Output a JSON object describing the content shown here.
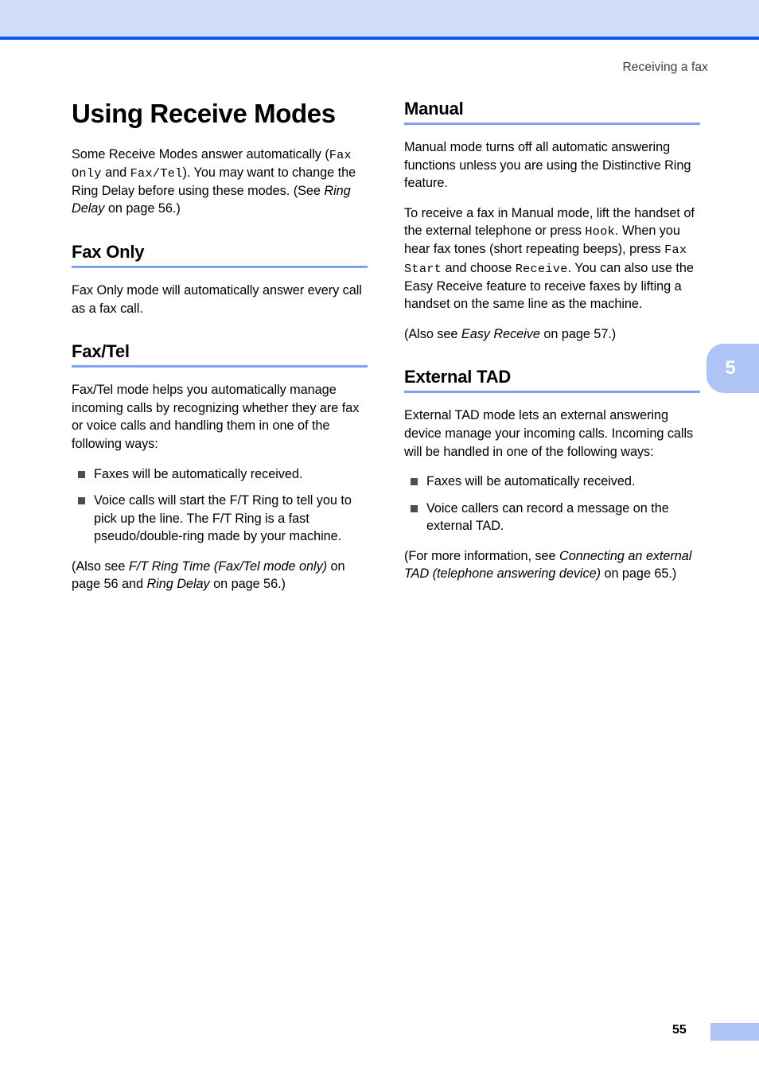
{
  "header": {
    "running_head": "Receiving a fax",
    "band_color": "#d2ddfb",
    "rule_color": "#0a58f0"
  },
  "chapter_tab": {
    "number": "5",
    "color": "#aec4f5",
    "text_color": "#ffffff"
  },
  "footer": {
    "page_number": "55",
    "block_color": "#aec4f5"
  },
  "accent": {
    "heading_rule": "#7fa2f2",
    "bullet_square": "#4d4d4d"
  },
  "title": "Using Receive Modes",
  "intro": {
    "p1_a": "Some Receive Modes answer automatically (",
    "p1_mono1": "Fax Only",
    "p1_b": " and ",
    "p1_mono2": "Fax/Tel",
    "p1_c": "). You may want to change the Ring Delay before using these modes. (See ",
    "p1_ital": "Ring Delay",
    "p1_d": " on page 56.)"
  },
  "sections": {
    "fax_only": {
      "heading": "Fax Only",
      "p1": "Fax Only mode will automatically answer every call as a fax call."
    },
    "fax_tel": {
      "heading": "Fax/Tel",
      "p1": "Fax/Tel mode helps you automatically manage incoming calls by recognizing whether they are fax or voice calls and handling them in one of the following ways:",
      "bullets": [
        "Faxes will be automatically received.",
        "Voice calls will start the F/T Ring to tell you to pick up the line. The F/T Ring is a fast pseudo/double-ring made by your machine."
      ],
      "p2_a": "(Also see ",
      "p2_ital1": "F/T Ring Time (Fax/Tel mode only)",
      "p2_b": " on page 56 and ",
      "p2_ital2": "Ring Delay",
      "p2_c": " on page 56.)"
    },
    "manual": {
      "heading": "Manual",
      "p1": "Manual mode turns off all automatic answering functions unless you are using the Distinctive Ring feature.",
      "p2_a": "To receive a fax in Manual mode, lift the handset of the external telephone or press ",
      "p2_mono1": "Hook",
      "p2_b": ". When you hear fax tones (short repeating beeps), press ",
      "p2_mono2": "Fax Start",
      "p2_c": " and choose ",
      "p2_mono3": "Receive",
      "p2_d": ". You can also use the Easy Receive feature to receive faxes by lifting a handset on the same line as the machine.",
      "p3_a": "(Also see ",
      "p3_ital": "Easy Receive",
      "p3_b": " on page 57.)"
    },
    "external_tad": {
      "heading": "External TAD",
      "p1": "External TAD mode lets an external answering device manage your incoming calls. Incoming calls will be handled in one of the following ways:",
      "bullets": [
        "Faxes will be automatically received.",
        "Voice callers can record a message on the external TAD."
      ],
      "p2_a": "(For more information, see ",
      "p2_ital": "Connecting an external TAD (telephone answering device)",
      "p2_b": " on page 65.)"
    }
  }
}
